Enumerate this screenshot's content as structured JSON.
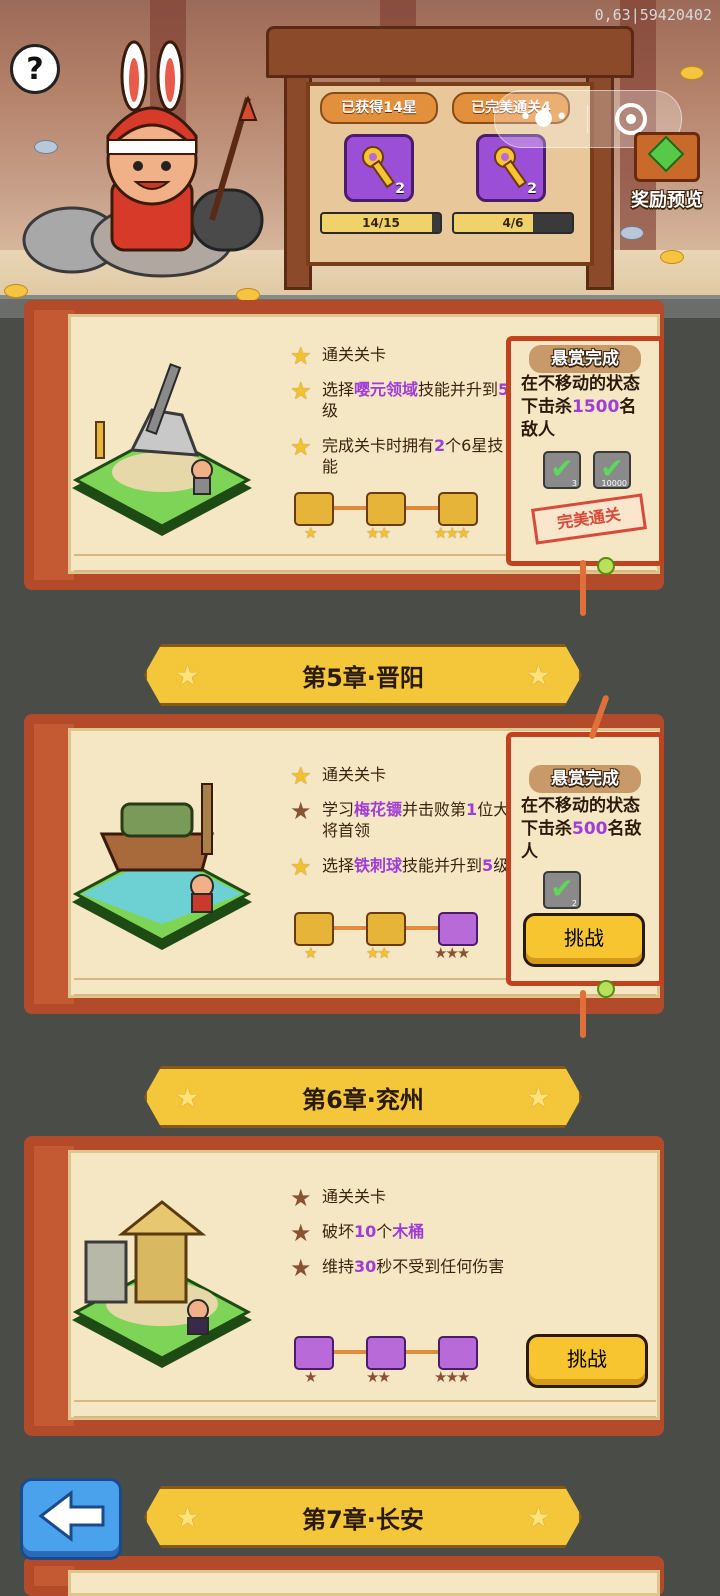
{
  "header": {
    "debug_text": "0,63|59420402",
    "help_symbol": "?",
    "progress": [
      {
        "title": "已获得14星",
        "key_count": "2",
        "progress_text": "14/15",
        "progress_fraction": 0.933
      },
      {
        "title": "已完美通关4",
        "key_count": "2",
        "progress_text": "4/6",
        "progress_fraction": 0.667
      }
    ],
    "reward_preview_label": "奖励预览"
  },
  "chapters": [
    {
      "objectives": [
        {
          "text": [
            "通关关卡"
          ],
          "star": "gold"
        },
        {
          "text": [
            "选择",
            "{嘤元领域}",
            "技能并升到",
            "{5}",
            "级"
          ],
          "star": "gold"
        },
        {
          "text": [
            "完成关卡时拥有",
            "{2}",
            "个6星技能"
          ],
          "star": "gold"
        }
      ],
      "chest_stars": [
        "★",
        "★★",
        "★★★"
      ],
      "bounty": {
        "title": "悬赏完成",
        "desc": [
          "在不移动的状态下击杀",
          "{1500}",
          "名敌人"
        ],
        "checks": [
          "3",
          "10000"
        ],
        "stamp": "完美通关"
      }
    },
    {
      "banner": "第5章·晋阳",
      "objectives": [
        {
          "text": [
            "通关关卡"
          ],
          "star": "gold"
        },
        {
          "text": [
            "学习",
            "{梅花镖}",
            "并击败第",
            "{1}",
            "位大将首领"
          ],
          "star": "dark"
        },
        {
          "text": [
            "选择",
            "{铁刺球}",
            "技能并升到",
            "{5}",
            "级"
          ],
          "star": "gold"
        }
      ],
      "chest_stars": [
        "★",
        "★★",
        "★★★"
      ],
      "bounty": {
        "title": "悬赏完成",
        "desc": [
          "在不移动的状态下击杀",
          "{500}",
          "名敌人"
        ],
        "checks": [
          "2"
        ],
        "button": "挑战"
      }
    },
    {
      "banner": "第6章·兖州",
      "objectives": [
        {
          "text": [
            "通关关卡"
          ],
          "star": "dark"
        },
        {
          "text": [
            "破坏",
            "{10}",
            "个",
            "{木桶}"
          ],
          "star": "dark"
        },
        {
          "text": [
            "维持",
            "{30}",
            "秒不受到任何伤害"
          ],
          "star": "dark"
        }
      ],
      "chest_stars": [
        "★",
        "★★",
        "★★★"
      ],
      "button": "挑战"
    },
    {
      "banner": "第7章·长安"
    }
  ],
  "colors": {
    "gold_star": "#f2c12e",
    "dark_star": "#8a5234",
    "highlight": "#a03cd8",
    "button": "#f7c530"
  },
  "icons": [
    "help-icon",
    "key-icon",
    "chest-icon",
    "check-icon",
    "back-arrow-icon",
    "star-icon"
  ]
}
